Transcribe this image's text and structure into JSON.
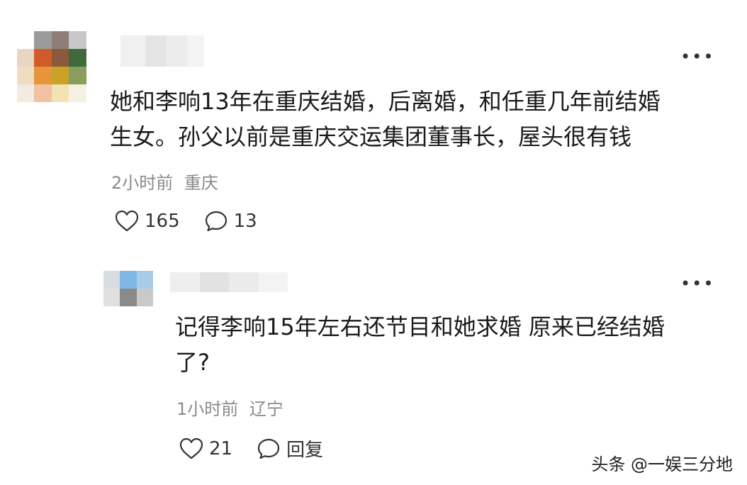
{
  "comments": [
    {
      "text_line1": "她和李响13年在重庆结婚，后离婚，和任重几年前结婚",
      "text_line2": "生女。孙父以前是重庆交运集团董事长，屋头很有钱",
      "time": "2小时前",
      "location": "重庆",
      "likes": "165",
      "replies": "13",
      "more_icon": "more-icon"
    },
    {
      "text_line1": "记得李响15年左右还节目和她求婚 原来已经结婚",
      "text_line2": "了?",
      "time": "1小时前",
      "location": "辽宁",
      "likes": "21",
      "reply_label": "回复",
      "more_icon": "more-icon"
    }
  ],
  "watermark": "头条 @一娱三分地",
  "colors": {
    "meta_gray": "#8a8a8a",
    "text": "#1a1a1a"
  }
}
